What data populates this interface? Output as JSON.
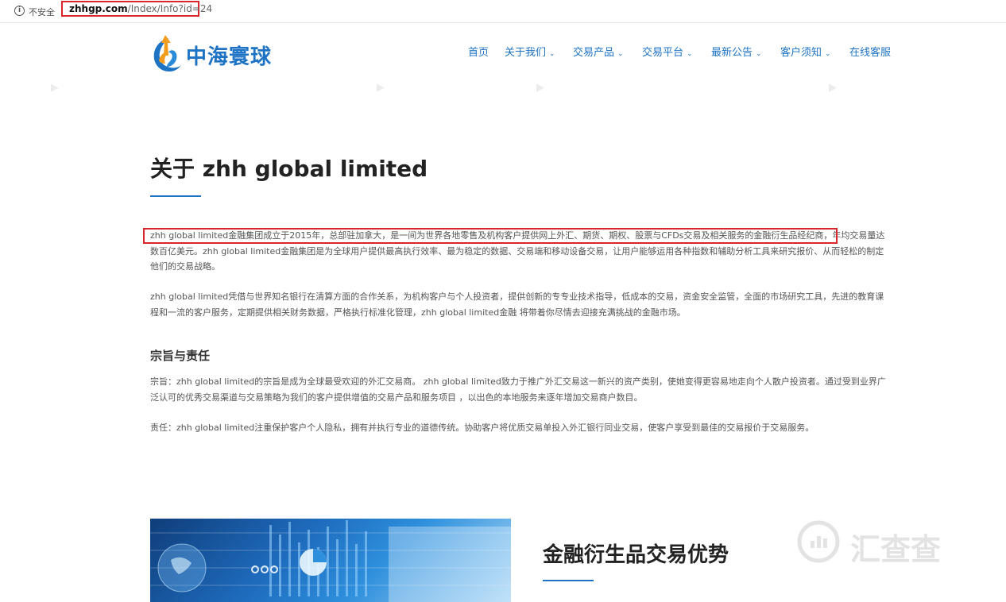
{
  "address_bar": {
    "security_label": "不安全",
    "url_domain": "zhhgp.com",
    "url_path": "/Index/Info?id=24"
  },
  "brand": {
    "name": "中海寰球"
  },
  "nav": {
    "items": [
      {
        "label": "首页",
        "has_dropdown": false
      },
      {
        "label": "关于我们",
        "has_dropdown": true
      },
      {
        "label": "交易产品",
        "has_dropdown": true
      },
      {
        "label": "交易平台",
        "has_dropdown": true
      },
      {
        "label": "最新公告",
        "has_dropdown": true
      },
      {
        "label": "客户须知",
        "has_dropdown": true
      },
      {
        "label": "在线客服",
        "has_dropdown": false
      }
    ],
    "dropdown_glyph": "⌄"
  },
  "main": {
    "title": "关于 zhh global limited",
    "intro": {
      "line1": "zhh global limited金融集团成立于2015年，总部驻加拿大，是一间为世界各地零售及机构客户提供网上外汇、期货、期权、股票与CFDs交易及相关服务的金融衍生品经纪商，年均交易量达",
      "line2": "数百亿美元。zhh global limited金融集团是为全球用户提供最高执行效率、最为稳定的数据、交易端和移动设备交易，让用户能够运用各种指数和辅助分析工具来研究报价、从而轻松的制定",
      "line3": "他们的交易战略。"
    },
    "paragraph2": {
      "line1": "zhh global limited凭借与世界知名银行在清算方面的合作关系，为机构客户与个人投资者，提供创新的专专业技术指导，低成本的交易，资金安全监管，全面的市场研究工具，先进的教育课",
      "line2": "程和一流的客户服务，定期提供相关财务数据，严格执行标准化管理，zhh global limited金融 将带着你尽情去迎接充满挑战的金融市场。"
    },
    "section_title": "宗旨与责任",
    "mission": {
      "line1": "宗旨：zhh global limited的宗旨是成为全球最受欢迎的外汇交易商。 zhh global limited致力于推广外汇交易这一新兴的资产类别，使她变得更容易地走向个人散户投资者。通过受到业界广",
      "line2": "泛认可的优秀交易渠道与交易策略为我们的客户提供增值的交易产品和服务项目 ，以出色的本地服务来逐年增加交易商户数目。"
    },
    "responsibility": "责任：zhh global limited注重保护客户个人隐私，拥有并执行专业的道德传统。协助客户将优质交易单投入外汇银行同业交易，使客户享受到最佳的交易报价于交易服务。",
    "feature_title": "金融衍生品交易优势"
  },
  "watermark": {
    "text": "汇查查"
  },
  "colors": {
    "accent": "#1e73c4",
    "highlight_border": "#d9262b",
    "logo_orange": "#f39c1e"
  }
}
